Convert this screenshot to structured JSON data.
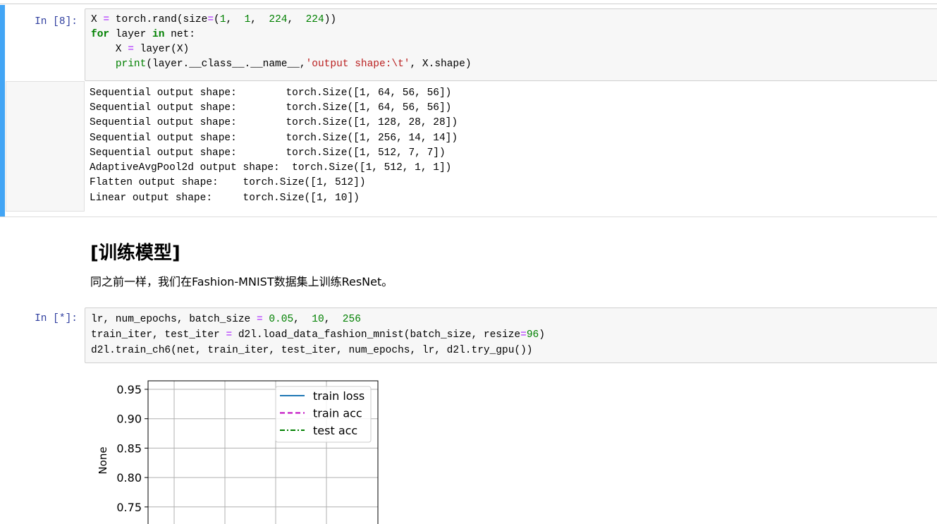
{
  "cell1": {
    "prompt": "In  [8]:",
    "code": {
      "l1": {
        "a": "X ",
        "b": "=",
        "c": " torch.rand(size",
        "d": "=",
        "e": "(",
        "n1": "1",
        "f": ",  ",
        "n2": "1",
        "g": ",  ",
        "n3": "224",
        "h": ",  ",
        "n4": "224",
        "i": "))"
      },
      "l2": {
        "kw1": "for",
        "a": " layer ",
        "kw2": "in",
        "b": " net:"
      },
      "l3": {
        "a": "    X ",
        "b": "=",
        "c": " layer(X)"
      },
      "l4": {
        "a": "    ",
        "fn": "print",
        "b": "(layer.__class__.__name__,",
        "s": "'output shape:\\t'",
        "c": ", X.shape)"
      }
    },
    "outputs": [
      "Sequential output shape:        torch.Size([1, 64, 56, 56])",
      "Sequential output shape:        torch.Size([1, 64, 56, 56])",
      "Sequential output shape:        torch.Size([1, 128, 28, 28])",
      "Sequential output shape:        torch.Size([1, 256, 14, 14])",
      "Sequential output shape:        torch.Size([1, 512, 7, 7])",
      "AdaptiveAvgPool2d output shape:  torch.Size([1, 512, 1, 1])",
      "Flatten output shape:    torch.Size([1, 512])",
      "Linear output shape:     torch.Size([1, 10])"
    ]
  },
  "markdown": {
    "title": "[训练模型]",
    "paragraph": "同之前一样，我们在Fashion-MNIST数据集上训练ResNet。"
  },
  "cell2": {
    "prompt": "In  [*]:",
    "code": {
      "l1": {
        "a": "lr, num_epochs, batch_size ",
        "b": "=",
        "c": " ",
        "n1": "0.05",
        "d": ",  ",
        "n2": "10",
        "e": ",  ",
        "n3": "256"
      },
      "l2": {
        "a": "train_iter, test_iter ",
        "b": "=",
        "c": " d2l.load_data_fashion_mnist(batch_size, resize",
        "d": "=",
        "n1": "96",
        "e": ")"
      },
      "l3": {
        "a": "d2l.train_ch6(net, train_iter, test_iter, num_epochs, lr, d2l.try_gpu())"
      }
    }
  },
  "chart_data": {
    "type": "line",
    "ylabel": "None",
    "xlabel": "",
    "yticks": [
      "0.95",
      "0.90",
      "0.85",
      "0.80",
      "0.75"
    ],
    "ytick_values": [
      0.95,
      0.9,
      0.85,
      0.8,
      0.75
    ],
    "ylim": [
      0.715,
      0.965
    ],
    "grid": true,
    "legend_position": "top-right",
    "series": [
      {
        "name": "train loss",
        "color": "#1f77b4",
        "style": "solid",
        "values": []
      },
      {
        "name": "train acc",
        "color": "#bf00bf",
        "style": "dashed",
        "values": []
      },
      {
        "name": "test acc",
        "color": "#008000",
        "style": "dashdot",
        "values": []
      }
    ]
  }
}
